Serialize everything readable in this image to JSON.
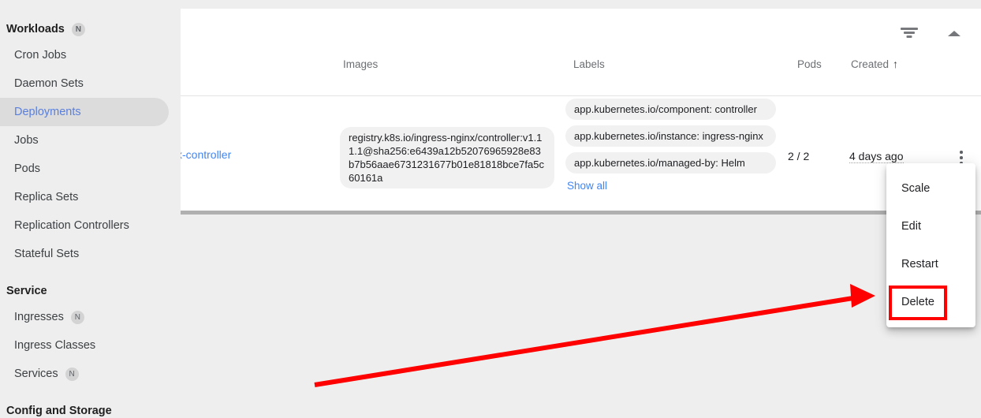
{
  "sidebar": {
    "sections": [
      {
        "type": "section",
        "label": "Workloads",
        "badge": "N",
        "name": "sidebar-section-workloads"
      },
      {
        "type": "item",
        "label": "Cron Jobs",
        "badge": "",
        "active": false,
        "name": "sidebar-item-cron-jobs"
      },
      {
        "type": "item",
        "label": "Daemon Sets",
        "badge": "",
        "active": false,
        "name": "sidebar-item-daemon-sets"
      },
      {
        "type": "item",
        "label": "Deployments",
        "badge": "",
        "active": true,
        "name": "sidebar-item-deployments"
      },
      {
        "type": "item",
        "label": "Jobs",
        "badge": "",
        "active": false,
        "name": "sidebar-item-jobs"
      },
      {
        "type": "item",
        "label": "Pods",
        "badge": "",
        "active": false,
        "name": "sidebar-item-pods"
      },
      {
        "type": "item",
        "label": "Replica Sets",
        "badge": "",
        "active": false,
        "name": "sidebar-item-replica-sets"
      },
      {
        "type": "item",
        "label": "Replication Controllers",
        "badge": "",
        "active": false,
        "name": "sidebar-item-replication-controllers"
      },
      {
        "type": "item",
        "label": "Stateful Sets",
        "badge": "",
        "active": false,
        "name": "sidebar-item-stateful-sets"
      },
      {
        "type": "section",
        "label": "Service",
        "badge": "",
        "name": "sidebar-section-service"
      },
      {
        "type": "item",
        "label": "Ingresses",
        "badge": "N",
        "active": false,
        "name": "sidebar-item-ingresses"
      },
      {
        "type": "item",
        "label": "Ingress Classes",
        "badge": "",
        "active": false,
        "name": "sidebar-item-ingress-classes"
      },
      {
        "type": "item",
        "label": "Services",
        "badge": "N",
        "active": false,
        "name": "sidebar-item-services"
      },
      {
        "type": "section",
        "label": "Config and Storage",
        "badge": "",
        "name": "sidebar-section-config-and-storage"
      }
    ]
  },
  "table": {
    "columns": {
      "name": "",
      "images": "Images",
      "labels": "Labels",
      "pods": "Pods",
      "created": "Created",
      "created_sort_arrow": "↑",
      "actions": ""
    },
    "row": {
      "name": "x-controller",
      "image": "registry.k8s.io/ingress-nginx/controller:v1.11.1@sha256:e6439a12b52076965928e83b7b56aae6731231677b01e81818bce7fa5c60161a",
      "labels": [
        "app.kubernetes.io/component: controller",
        "app.kubernetes.io/instance: ingress-nginx",
        "app.kubernetes.io/managed-by: Helm"
      ],
      "show_all": "Show all",
      "pods": "2 / 2",
      "created": "4 days ago"
    }
  },
  "toolbar": {
    "filter_icon": "filter-list-icon",
    "collapse_icon": "collapse-up-icon",
    "row_menu_icon": "more-vert-icon"
  },
  "context_menu": {
    "items": [
      {
        "label": "Scale",
        "name": "menu-item-scale",
        "highlighted": false
      },
      {
        "label": "Edit",
        "name": "menu-item-edit",
        "highlighted": false
      },
      {
        "label": "Restart",
        "name": "menu-item-restart",
        "highlighted": false
      },
      {
        "label": "Delete",
        "name": "menu-item-delete",
        "highlighted": true
      }
    ]
  },
  "annotation": {
    "highlight_color": "#ff0000",
    "arrow_color": "#ff0000"
  }
}
